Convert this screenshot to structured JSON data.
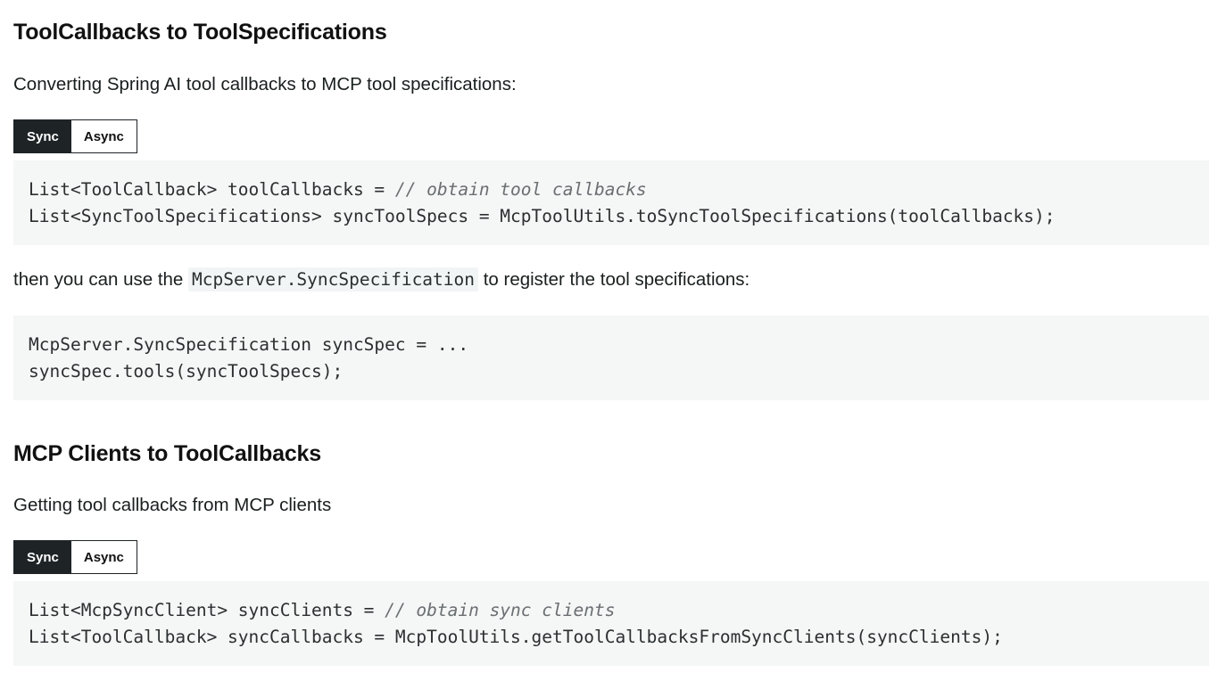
{
  "section1": {
    "heading": "ToolCallbacks to ToolSpecifications",
    "intro": "Converting Spring AI tool callbacks to MCP tool specifications:",
    "tabs": [
      "Sync",
      "Async"
    ],
    "code1": {
      "line1_code": "List<ToolCallback> toolCallbacks = ",
      "line1_comment": "// obtain tool callbacks",
      "line2": "List<SyncToolSpecifications> syncToolSpecs = McpToolUtils.toSyncToolSpecifications(toolCallbacks);"
    },
    "then_before": "then you can use the ",
    "then_code": "McpServer.SyncSpecification",
    "then_after": " to register the tool specifications:",
    "code2": {
      "line1": "McpServer.SyncSpecification syncSpec = ...",
      "line2": "syncSpec.tools(syncToolSpecs);"
    }
  },
  "section2": {
    "heading": "MCP Clients to ToolCallbacks",
    "intro": "Getting tool callbacks from MCP clients",
    "tabs": [
      "Sync",
      "Async"
    ],
    "code": {
      "line1_code": "List<McpSyncClient> syncClients = ",
      "line1_comment": "// obtain sync clients",
      "line2": "List<ToolCallback> syncCallbacks = McpToolUtils.getToolCallbacksFromSyncClients(syncClients);"
    }
  }
}
